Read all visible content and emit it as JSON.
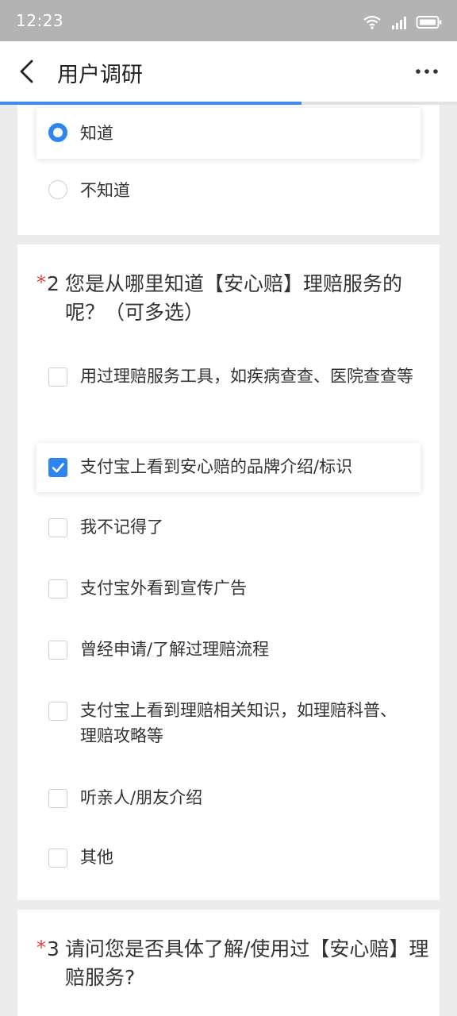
{
  "status_bar": {
    "time": "12:23"
  },
  "header": {
    "title": "用户调研",
    "progress": 0.66
  },
  "question1": {
    "options": [
      {
        "label": "知道",
        "checked": true
      },
      {
        "label": "不知道",
        "checked": false
      }
    ]
  },
  "question2": {
    "required_mark": "*",
    "number": "2",
    "text": "您是从哪里知道【安心赔】理赔服务的呢？（可多选）",
    "options": [
      {
        "label": "用过理赔服务工具，如疾病查查、医院查查等",
        "checked": false
      },
      {
        "label": "支付宝上看到安心赔的品牌介绍/标识",
        "checked": true
      },
      {
        "label": "我不记得了",
        "checked": false
      },
      {
        "label": "支付宝外看到宣传广告",
        "checked": false
      },
      {
        "label": "曾经申请/了解过理赔流程",
        "checked": false
      },
      {
        "label": "支付宝上看到理赔相关知识，如理赔科普、理赔攻略等",
        "checked": false
      },
      {
        "label": "听亲人/朋友介绍",
        "checked": false
      },
      {
        "label": "其他",
        "checked": false
      }
    ]
  },
  "question3": {
    "required_mark": "*",
    "number": "3",
    "text": "请问您是否具体了解/使用过【安心赔】理赔服务?"
  },
  "colors": {
    "accent": "#2d86f0",
    "required": "#e8433a",
    "status_bar": "#b3b3b3"
  },
  "icons": [
    "back-icon",
    "more-icon",
    "wifi-icon",
    "signal-icon",
    "battery-icon",
    "check-icon"
  ]
}
